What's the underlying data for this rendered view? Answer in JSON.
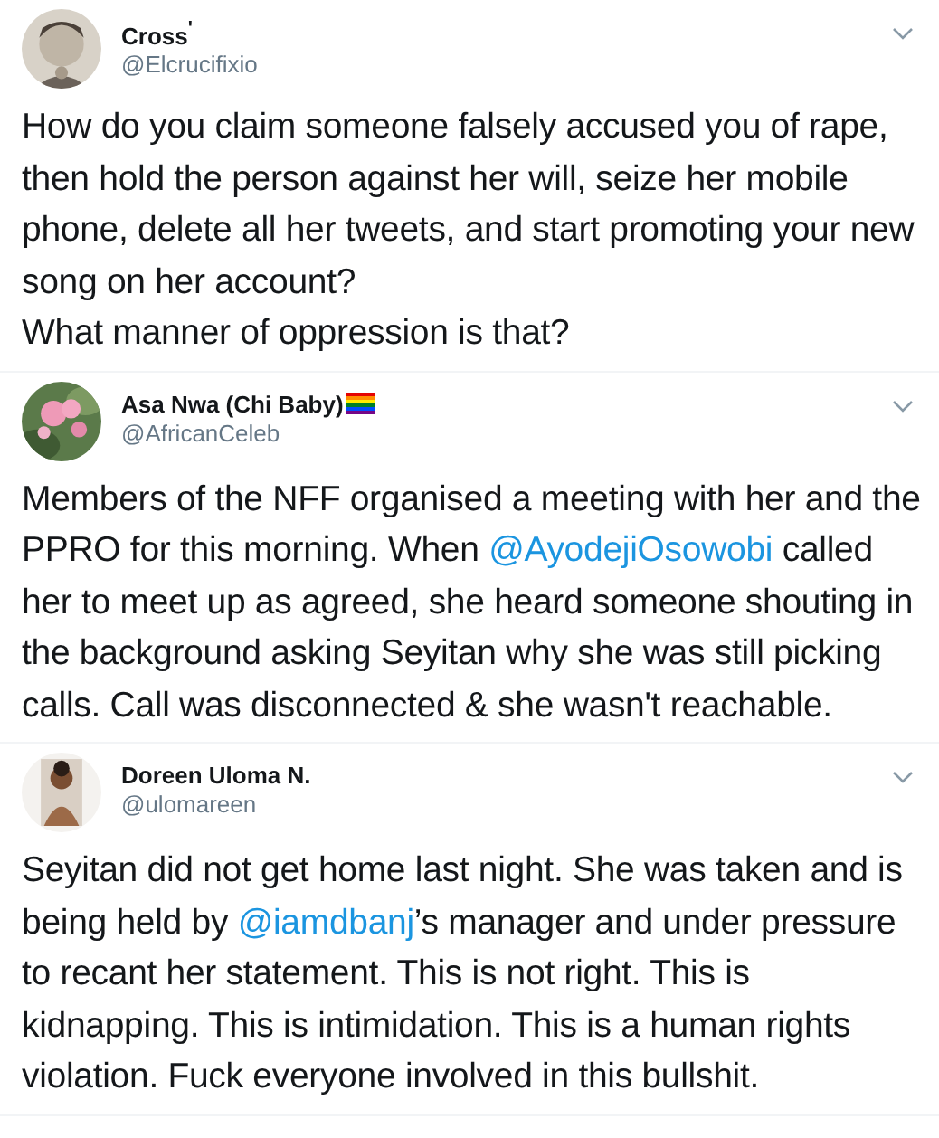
{
  "tweets": [
    {
      "user": {
        "name": "Cross$^{'}$",
        "handle": "@Elcrucifixio",
        "pride_flag": false
      },
      "body": [
        {
          "kind": "plain",
          "text": "How do you claim someone falsely accused you of rape, then hold the person against her will, seize her mobile phone, delete all her tweets, and start promoting your new song on her account?\nWhat manner of oppression is that?"
        }
      ]
    },
    {
      "user": {
        "name": "Asa Nwa (Chi Baby)",
        "handle": "@AfricanCeleb",
        "pride_flag": true
      },
      "body": [
        {
          "kind": "plain",
          "text": "Members of the NFF organised a meeting with her and the PPRO for this morning. When "
        },
        {
          "kind": "mention",
          "text": "@AyodejiOsowobi"
        },
        {
          "kind": "plain",
          "text": " called her to meet up as agreed, she heard someone shouting in the background asking Seyitan why she was still picking calls. Call was disconnected & she wasn't reachable."
        }
      ]
    },
    {
      "user": {
        "name": "Doreen Uloma N.",
        "handle": "@ulomareen",
        "pride_flag": false
      },
      "body": [
        {
          "kind": "plain",
          "text": "Seyitan did not get home last night. She was taken and is being held by "
        },
        {
          "kind": "mention",
          "text": "@iamdbanj"
        },
        {
          "kind": "plain",
          "text": "’s manager and under pressure to recant her statement. This is not right. This is kidnapping. This is intimidation. This is a human rights violation. Fuck everyone involved in this bullshit."
        }
      ]
    }
  ]
}
